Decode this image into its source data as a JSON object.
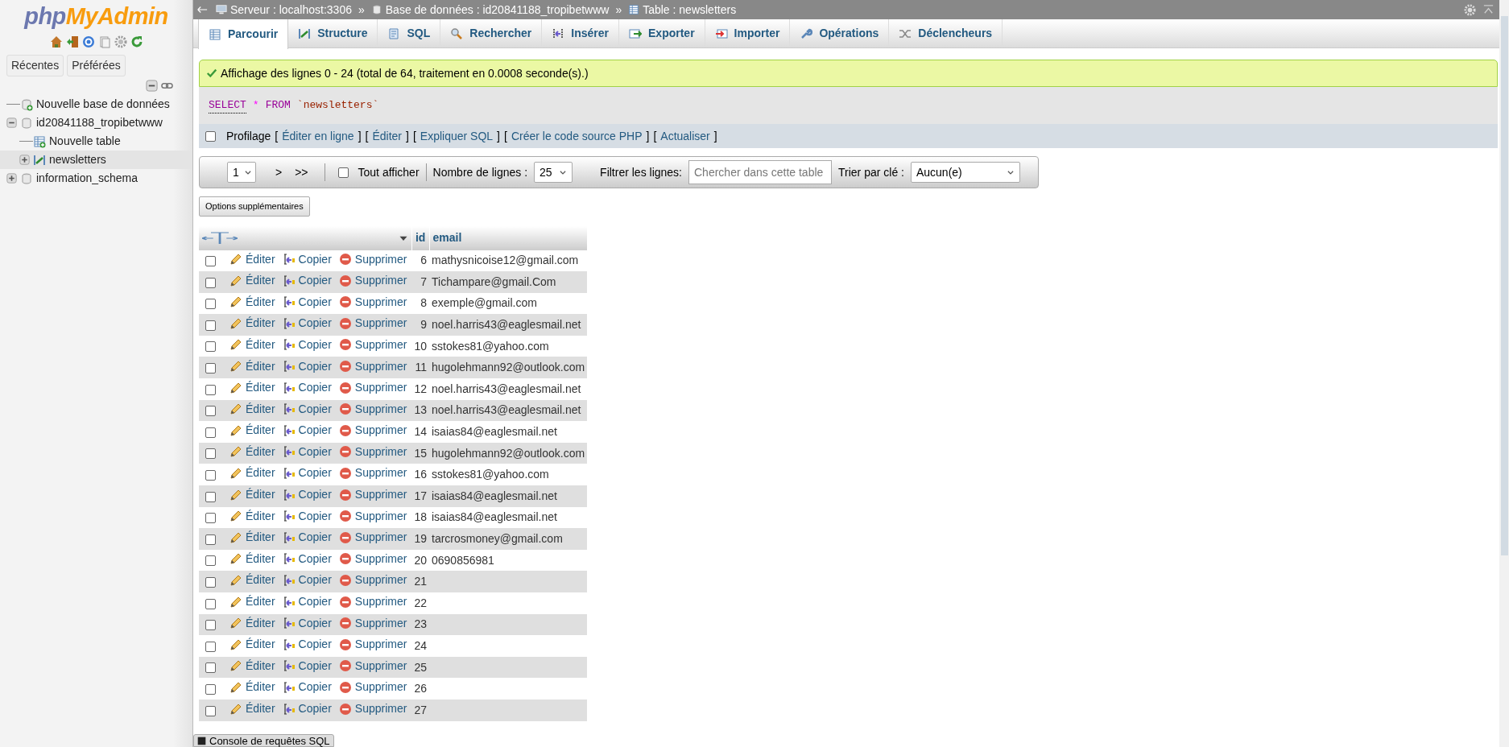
{
  "sidebar": {
    "logo": {
      "part_1": "php",
      "part_2": "MyAdmin"
    },
    "buttons": [
      "Récentes",
      "Préférées"
    ],
    "tree": [
      {
        "label": "Nouvelle base de données",
        "kind": "new-db",
        "selected": false
      },
      {
        "label": "id20841188_tropibetwww",
        "kind": "db",
        "expanded": true,
        "selected": false,
        "children": [
          {
            "label": "Nouvelle table",
            "kind": "new-table",
            "selected": false
          },
          {
            "label": "newsletters",
            "kind": "table",
            "expanded": false,
            "selected": true
          }
        ]
      },
      {
        "label": "information_schema",
        "kind": "db",
        "expanded": false,
        "selected": false
      }
    ]
  },
  "breadcrumb": [
    {
      "label": "Serveur : localhost:3306",
      "kind": "server",
      "separator": "»"
    },
    {
      "label": "Base de données : id20841188_tropibetwww",
      "kind": "db",
      "separator": "»"
    },
    {
      "label": "Table : newsletters",
      "kind": "table"
    }
  ],
  "tabs": [
    {
      "label": "Parcourir",
      "kind": "browse",
      "selected": true
    },
    {
      "label": "Structure",
      "kind": "structure",
      "selected": false
    },
    {
      "label": "SQL",
      "kind": "sql",
      "selected": false
    },
    {
      "label": "Rechercher",
      "kind": "search",
      "selected": false
    },
    {
      "label": "Insérer",
      "kind": "insert",
      "selected": false
    },
    {
      "label": "Exporter",
      "kind": "export",
      "selected": false
    },
    {
      "label": "Importer",
      "kind": "import",
      "selected": false
    },
    {
      "label": "Opérations",
      "kind": "operations",
      "selected": false
    },
    {
      "label": "Déclencheurs",
      "kind": "triggers",
      "selected": false
    }
  ],
  "message": "Affichage des lignes 0 - 24 (total de 64, traitement en 0.0008 seconde(s).)",
  "sql": [
    {
      "text": "SELECT",
      "kind": "keyword"
    },
    {
      "text": "*",
      "kind": "operator"
    },
    {
      "text": "FROM",
      "kind": "keyword"
    },
    {
      "text": "`newsletters`",
      "kind": "name"
    }
  ],
  "profiling": {
    "label": "Profilage",
    "checked": false,
    "links": [
      {
        "open": "[",
        "label": "Éditer en ligne",
        "close": "]"
      },
      {
        "open": "[",
        "label": "Éditer",
        "close": "]"
      },
      {
        "open": "[",
        "label": "Expliquer SQL",
        "close": "]"
      },
      {
        "open": "[",
        "label": "Créer le code source PHP",
        "close": "]"
      },
      {
        "open": "[",
        "label": "Actualiser",
        "close": "]"
      }
    ]
  },
  "navigation": {
    "page": "1",
    "buttons": [
      ">",
      ">>"
    ],
    "show_all": {
      "label": "Tout afficher",
      "checked": false
    },
    "rows_label": "Nombre de lignes :",
    "rows_value": "25",
    "filter_label": "Filtrer les lignes:",
    "filter_placeholder": "Chercher dans cette table",
    "sort_label": "Trier par clé :",
    "sort_value": "Aucun(e)"
  },
  "options_button": "Options supplémentaires",
  "table": {
    "columns": [
      "id",
      "email"
    ],
    "rows": [
      {
        "checked": false,
        "edit": "Éditer",
        "copy": "Copier",
        "delete": "Supprimer",
        "id": "6",
        "email": "mathysnicoise12@gmail.com"
      },
      {
        "checked": false,
        "edit": "Éditer",
        "copy": "Copier",
        "delete": "Supprimer",
        "id": "7",
        "email": "Tichampare@gmail.Com"
      },
      {
        "checked": false,
        "edit": "Éditer",
        "copy": "Copier",
        "delete": "Supprimer",
        "id": "8",
        "email": "exemple@gmail.com"
      },
      {
        "checked": false,
        "edit": "Éditer",
        "copy": "Copier",
        "delete": "Supprimer",
        "id": "9",
        "email": "noel.harris43@eaglesmail.net"
      },
      {
        "checked": false,
        "edit": "Éditer",
        "copy": "Copier",
        "delete": "Supprimer",
        "id": "10",
        "email": "sstokes81@yahoo.com"
      },
      {
        "checked": false,
        "edit": "Éditer",
        "copy": "Copier",
        "delete": "Supprimer",
        "id": "11",
        "email": "hugolehmann92@outlook.com"
      },
      {
        "checked": false,
        "edit": "Éditer",
        "copy": "Copier",
        "delete": "Supprimer",
        "id": "12",
        "email": "noel.harris43@eaglesmail.net"
      },
      {
        "checked": false,
        "edit": "Éditer",
        "copy": "Copier",
        "delete": "Supprimer",
        "id": "13",
        "email": "noel.harris43@eaglesmail.net"
      },
      {
        "checked": false,
        "edit": "Éditer",
        "copy": "Copier",
        "delete": "Supprimer",
        "id": "14",
        "email": "isaias84@eaglesmail.net"
      },
      {
        "checked": false,
        "edit": "Éditer",
        "copy": "Copier",
        "delete": "Supprimer",
        "id": "15",
        "email": "hugolehmann92@outlook.com"
      },
      {
        "checked": false,
        "edit": "Éditer",
        "copy": "Copier",
        "delete": "Supprimer",
        "id": "16",
        "email": "sstokes81@yahoo.com"
      },
      {
        "checked": false,
        "edit": "Éditer",
        "copy": "Copier",
        "delete": "Supprimer",
        "id": "17",
        "email": "isaias84@eaglesmail.net"
      },
      {
        "checked": false,
        "edit": "Éditer",
        "copy": "Copier",
        "delete": "Supprimer",
        "id": "18",
        "email": "isaias84@eaglesmail.net"
      },
      {
        "checked": false,
        "edit": "Éditer",
        "copy": "Copier",
        "delete": "Supprimer",
        "id": "19",
        "email": "tarcrosmoney@gmail.com"
      },
      {
        "checked": false,
        "edit": "Éditer",
        "copy": "Copier",
        "delete": "Supprimer",
        "id": "20",
        "email": "0690856981"
      },
      {
        "checked": false,
        "edit": "Éditer",
        "copy": "Copier",
        "delete": "Supprimer",
        "id": "21"
      },
      {
        "checked": false,
        "edit": "Éditer",
        "copy": "Copier",
        "delete": "Supprimer",
        "id": "22"
      },
      {
        "checked": false,
        "edit": "Éditer",
        "copy": "Copier",
        "delete": "Supprimer",
        "id": "23"
      },
      {
        "checked": false,
        "edit": "Éditer",
        "copy": "Copier",
        "delete": "Supprimer",
        "id": "24"
      },
      {
        "checked": false,
        "edit": "Éditer",
        "copy": "Copier",
        "delete": "Supprimer",
        "id": "25"
      },
      {
        "checked": false,
        "edit": "Éditer",
        "copy": "Copier",
        "delete": "Supprimer",
        "id": "26"
      },
      {
        "checked": false,
        "edit": "Éditer",
        "copy": "Copier",
        "delete": "Supprimer",
        "id": "27"
      }
    ]
  },
  "console": "Console de requêtes SQL"
}
